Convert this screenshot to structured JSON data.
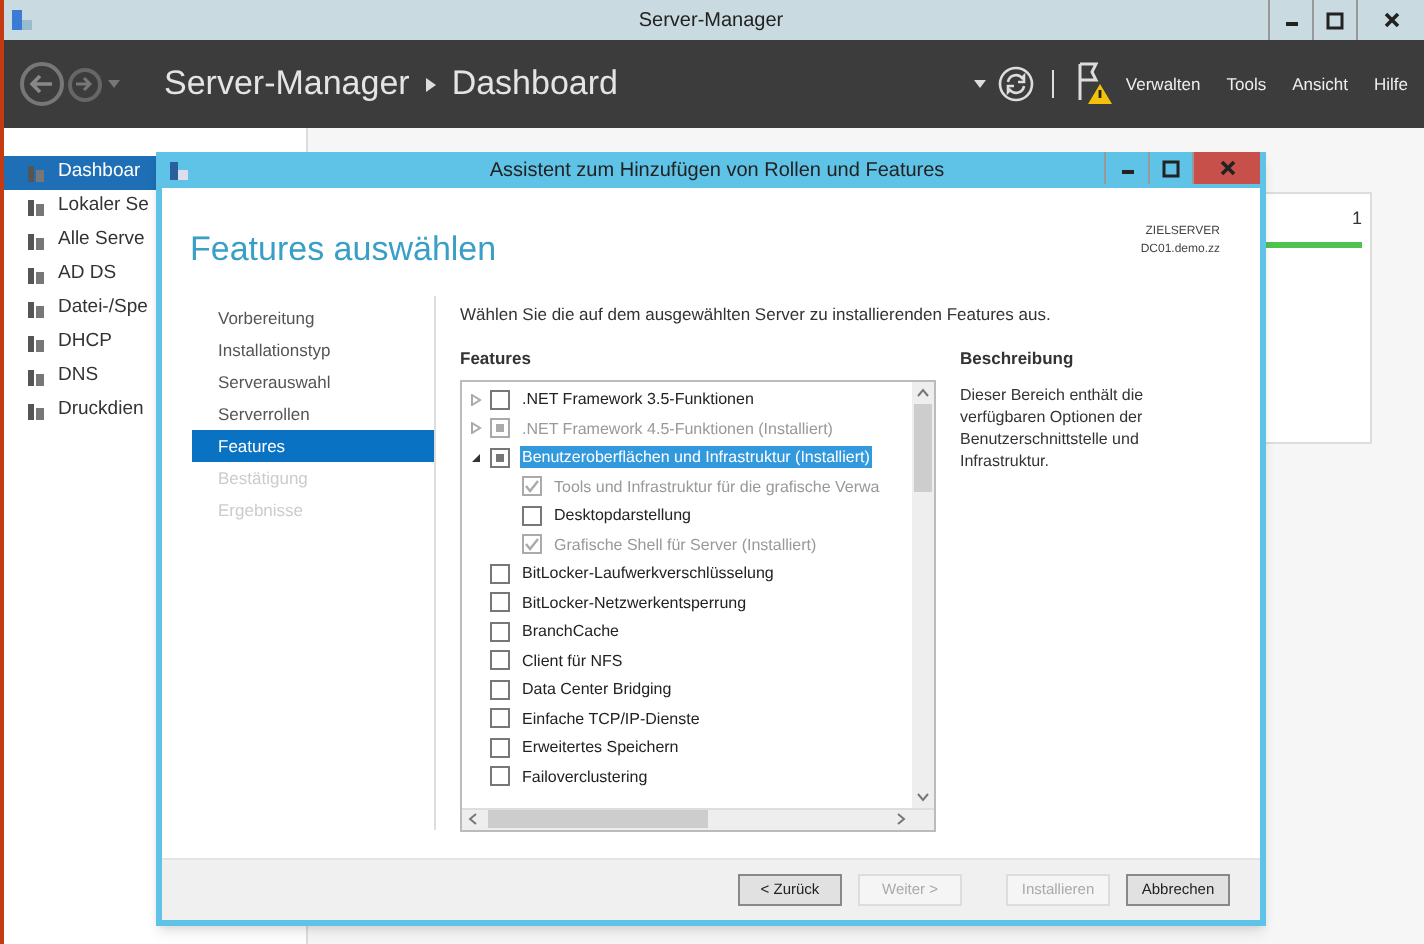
{
  "window": {
    "title": "Server-Manager"
  },
  "toolbar": {
    "breadcrumb": [
      "Server-Manager",
      "Dashboard"
    ],
    "menu": [
      "Verwalten",
      "Tools",
      "Ansicht",
      "Hilfe"
    ]
  },
  "sidebar": {
    "items": [
      {
        "label": "Dashboar",
        "selected": true
      },
      {
        "label": "Lokaler Se",
        "selected": false
      },
      {
        "label": "Alle Serve",
        "selected": false
      },
      {
        "label": "AD DS",
        "selected": false
      },
      {
        "label": "Datei-/Spe",
        "selected": false
      },
      {
        "label": "DHCP",
        "selected": false
      },
      {
        "label": "DNS",
        "selected": false
      },
      {
        "label": "Druckdien",
        "selected": false
      }
    ]
  },
  "tile": {
    "count": "1"
  },
  "dialog": {
    "title": "Assistent zum Hinzufügen von Rollen und Features",
    "heading": "Features auswählen",
    "target_label": "ZIELSERVER",
    "target_server": "DC01.demo.zz",
    "steps": [
      {
        "label": "Vorbereitung",
        "selected": false,
        "disabled": false
      },
      {
        "label": "Installationstyp",
        "selected": false,
        "disabled": false
      },
      {
        "label": "Serverauswahl",
        "selected": false,
        "disabled": false
      },
      {
        "label": "Serverrollen",
        "selected": false,
        "disabled": false
      },
      {
        "label": "Features",
        "selected": true,
        "disabled": false
      },
      {
        "label": "Bestätigung",
        "selected": false,
        "disabled": true
      },
      {
        "label": "Ergebnisse",
        "selected": false,
        "disabled": true
      }
    ],
    "instruction": "Wählen Sie die auf dem ausgewählten Server zu installierenden Features aus.",
    "features_label": "Features",
    "features": [
      {
        "label": ".NET Framework 3.5-Funktionen",
        "checked": false,
        "partial": false,
        "disabled": false,
        "selected": false,
        "expanded": false
      },
      {
        "label": ".NET Framework 4.5-Funktionen (Installiert)",
        "checked": false,
        "partial": true,
        "disabled": true,
        "selected": false,
        "expanded": false
      },
      {
        "label": "Benutzeroberflächen und Infrastruktur (Installiert)",
        "checked": false,
        "partial": true,
        "disabled": false,
        "selected": true,
        "expanded": true,
        "children": [
          {
            "label": "Tools und Infrastruktur für die grafische Verwa",
            "checked": true,
            "partial": false,
            "disabled": true,
            "selected": false
          },
          {
            "label": "Desktopdarstellung",
            "checked": false,
            "partial": false,
            "disabled": false,
            "selected": false
          },
          {
            "label": "Grafische Shell für Server (Installiert)",
            "checked": true,
            "partial": false,
            "disabled": true,
            "selected": false
          }
        ]
      },
      {
        "label": "BitLocker-Laufwerkverschlüsselung",
        "checked": false,
        "partial": false,
        "disabled": false,
        "selected": false
      },
      {
        "label": "BitLocker-Netzwerkentsperrung",
        "checked": false,
        "partial": false,
        "disabled": false,
        "selected": false
      },
      {
        "label": "BranchCache",
        "checked": false,
        "partial": false,
        "disabled": false,
        "selected": false
      },
      {
        "label": "Client für NFS",
        "checked": false,
        "partial": false,
        "disabled": false,
        "selected": false
      },
      {
        "label": "Data Center Bridging",
        "checked": false,
        "partial": false,
        "disabled": false,
        "selected": false
      },
      {
        "label": "Einfache TCP/IP-Dienste",
        "checked": false,
        "partial": false,
        "disabled": false,
        "selected": false
      },
      {
        "label": "Erweitertes Speichern",
        "checked": false,
        "partial": false,
        "disabled": false,
        "selected": false
      },
      {
        "label": "Failoverclustering",
        "checked": false,
        "partial": false,
        "disabled": false,
        "selected": false
      }
    ],
    "description_label": "Beschreibung",
    "description": "Dieser Bereich enthält die verfügbaren Optionen der Benutzerschnittstelle und Infrastruktur.",
    "buttons": [
      {
        "label": "< Zurück",
        "disabled": false
      },
      {
        "label": "Weiter >",
        "disabled": true
      },
      {
        "label": "Installieren",
        "disabled": true
      },
      {
        "label": "Abbrechen",
        "disabled": false
      }
    ]
  }
}
